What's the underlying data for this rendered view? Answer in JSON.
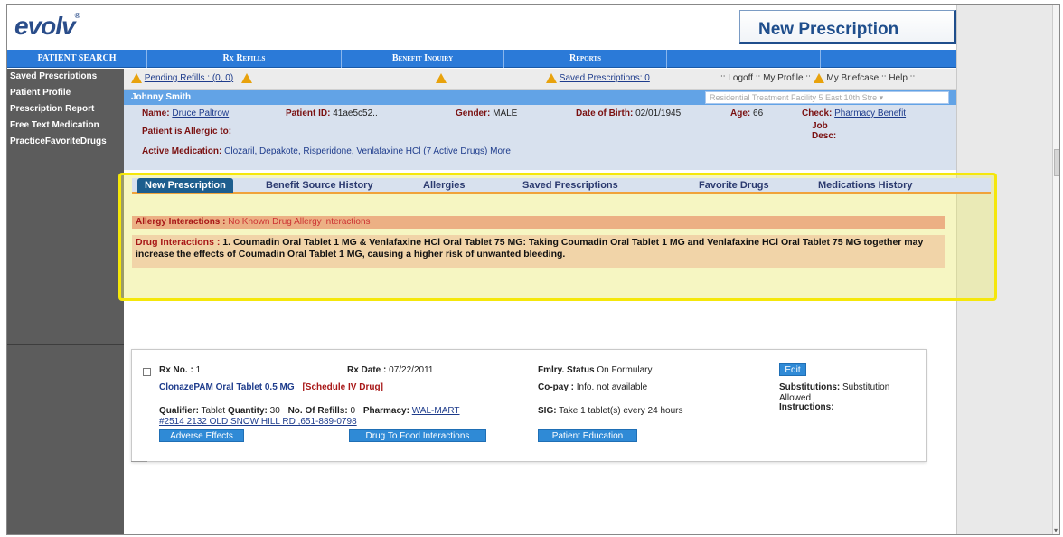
{
  "app": {
    "logo": "evolv",
    "logo_mark": "®",
    "page_title": "New Prescription"
  },
  "nav": [
    "PATIENT SEARCH",
    "Rx Refills",
    "Benefit Inquiry",
    "Reports",
    "",
    ""
  ],
  "sidebar": [
    "Saved Prescriptions",
    "Patient Profile",
    "Prescription Report",
    "Free Text Medication",
    "PracticeFavoriteDrugs"
  ],
  "refill_bar": {
    "pending_refills": "Pending Refills : (0, 0)",
    "saved_prescriptions": "Saved Prescriptions: 0",
    "logoff": ":: Logoff :: My Profile ::",
    "briefcase": "My Briefcase :: Help ::"
  },
  "patient": {
    "header_name": "Johnny Smith",
    "facility": "Residential Treatment Facility 5 East 10th Stre",
    "name_label": "Name:",
    "name": "Druce Paltrow",
    "id_label": "Patient ID:",
    "id": "41ae5c52..",
    "gender_label": "Gender:",
    "gender": "MALE",
    "dob_label": "Date of Birth:",
    "dob": "02/01/1945",
    "age_label": "Age:",
    "age": "66",
    "check_label": "Check:",
    "check_link": "Pharmacy Benefit",
    "allergic_label": "Patient is Allergic to:",
    "job_label": "Job",
    "desc_label": "Desc:",
    "active_med_label": "Active Medication:",
    "active_meds": "Clozaril, Depakote, Risperidone, Venlafaxine HCl (7 Active Drugs) More"
  },
  "tabs": [
    "New Prescription",
    "Benefit Source History",
    "Allergies",
    "Saved Prescriptions",
    "Favorite Drugs",
    "Medications History"
  ],
  "interactions": {
    "allergy_label": "Allergy Interactions :",
    "allergy_value": "No Known Drug Allergy interactions",
    "drug_label": "Drug Interactions :",
    "drug_text": "1. Coumadin Oral Tablet 1 MG & Venlafaxine HCl Oral Tablet 75 MG: Taking Coumadin Oral Tablet 1 MG and Venlafaxine HCl Oral Tablet 75 MG together may increase the effects of Coumadin Oral Tablet 1 MG, causing a higher risk of unwanted bleeding."
  },
  "rx": {
    "no_label": "Rx No. :",
    "no": "1",
    "date_label": "Rx Date :",
    "date": "07/22/2011",
    "fmlry_label": "Fmlry. Status",
    "fmlry": "On Formulary",
    "edit": "Edit",
    "drug": "ClonazePAM Oral Tablet 0.5 MG",
    "schedule": "[Schedule IV Drug]",
    "copay_label": "Co-pay :",
    "copay": "Info. not available",
    "subs_label": "Substitutions:",
    "subs": "Substitution",
    "subs2": "Allowed",
    "qualifier_label": "Qualifier:",
    "qualifier": "Tablet",
    "qty_label": "Quantity:",
    "qty": "30",
    "refills_label": "No. Of Refills:",
    "refills": "0",
    "pharmacy_label": "Pharmacy:",
    "pharmacy1": "WAL-MART",
    "pharmacy2": "#2514 2132 OLD SNOW HILL RD ,651-889-0798",
    "sig_label": "SIG:",
    "sig": "Take 1 tablet(s) every 24 hours",
    "instructions_label": "Instructions:",
    "btn_adverse": "Adverse Effects",
    "btn_food": "Drug To Food Interactions",
    "btn_education": "Patient Education"
  }
}
